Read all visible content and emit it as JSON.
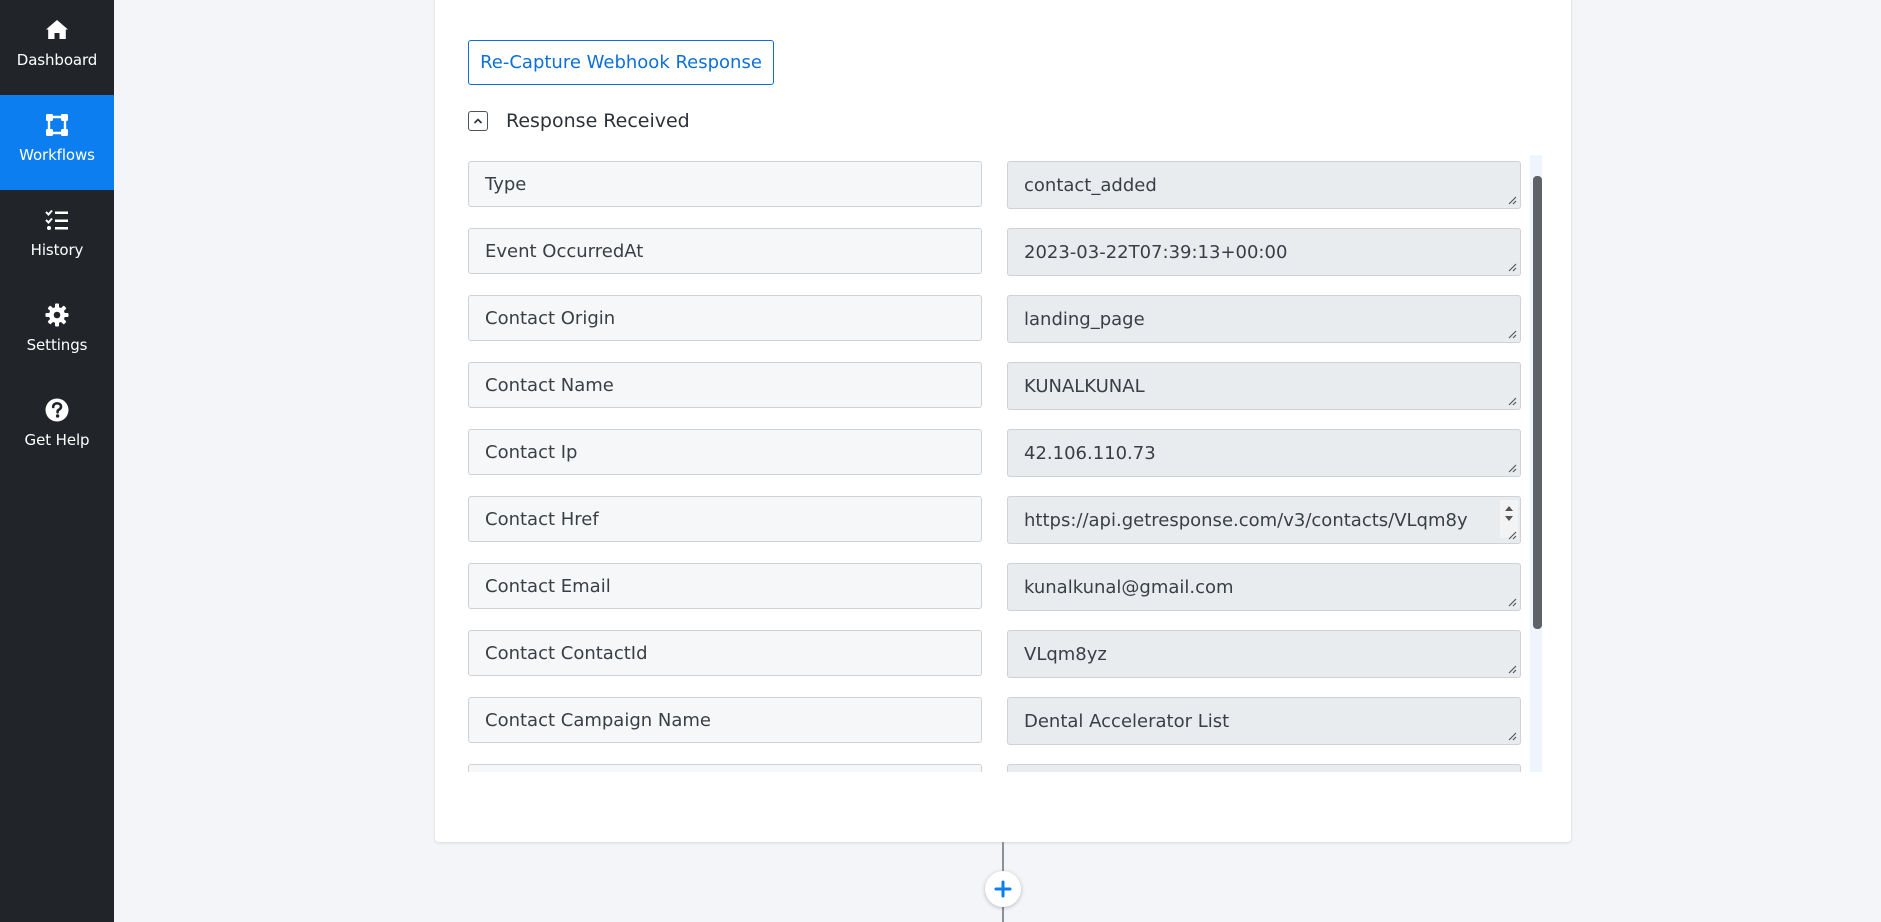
{
  "sidebar": {
    "items": [
      {
        "label": "Dashboard",
        "icon": "home-icon",
        "active": false
      },
      {
        "label": "Workflows",
        "icon": "workflow-icon",
        "active": true
      },
      {
        "label": "History",
        "icon": "checklist-icon",
        "active": false
      },
      {
        "label": "Settings",
        "icon": "gear-icon",
        "active": false
      },
      {
        "label": "Get Help",
        "icon": "help-icon",
        "active": false
      }
    ],
    "bg_color": "#212529",
    "active_color": "#0d7ef0"
  },
  "webhook": {
    "recapture_label": "Re-Capture Webhook Response",
    "response_title": "Response Received",
    "rows": [
      {
        "key": "Type",
        "value": "contact_added"
      },
      {
        "key": "Event OccurredAt",
        "value": "2023-03-22T07:39:13+00:00"
      },
      {
        "key": "Contact Origin",
        "value": "landing_page"
      },
      {
        "key": "Contact Name",
        "value": "KUNALKUNAL"
      },
      {
        "key": "Contact Ip",
        "value": "42.106.110.73"
      },
      {
        "key": "Contact Href",
        "value": "https://api.getresponse.com/v3/contacts/VLqm8y"
      },
      {
        "key": "Contact Email",
        "value": "kunalkunal@gmail.com"
      },
      {
        "key": "Contact ContactId",
        "value": "VLqm8yz"
      },
      {
        "key": "Contact Campaign Name",
        "value": "Dental Accelerator List"
      }
    ]
  },
  "colors": {
    "accent": "#0d6fd8",
    "page_bg": "#f3f5f8"
  }
}
